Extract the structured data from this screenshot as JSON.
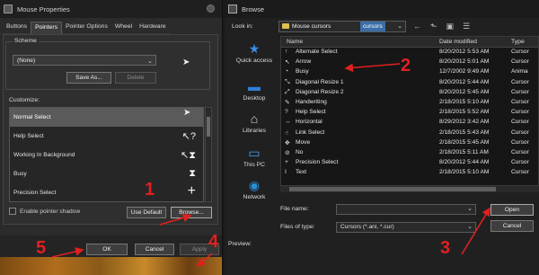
{
  "mouse_dialog": {
    "title": "Mouse Properties",
    "tabs": [
      {
        "label": "Buttons",
        "active": false
      },
      {
        "label": "Pointers",
        "active": true
      },
      {
        "label": "Pointer Options",
        "active": false
      },
      {
        "label": "Wheel",
        "active": false
      },
      {
        "label": "Hardware",
        "active": false
      }
    ],
    "scheme_label": "Scheme",
    "scheme_value": "(None)",
    "save_as_label": "Save As...",
    "delete_label": "Delete",
    "customize_label": "Customize:",
    "cursor_items": [
      {
        "label": "Normal Select",
        "selected": true,
        "icon": ""
      },
      {
        "label": "Help Select",
        "selected": false,
        "icon": "↖?"
      },
      {
        "label": "Working In Background",
        "selected": false,
        "icon": "↖⧗"
      },
      {
        "label": "Busy",
        "selected": false,
        "icon": "⧗"
      },
      {
        "label": "Precision Select",
        "selected": false,
        "icon": "+"
      }
    ],
    "shadow_label": "Enable pointer shadow",
    "use_default_label": "Use Default",
    "browse_label": "Browse...",
    "ok_label": "OK",
    "cancel_label": "Cancel",
    "apply_label": "Apply"
  },
  "browse_dialog": {
    "title": "Browse",
    "look_in_label": "Look in:",
    "look_in_value": "Mouse cursors",
    "look_in_selected": "cursors",
    "places": [
      {
        "label": "Quick access",
        "icon": "star-icon"
      },
      {
        "label": "Desktop",
        "icon": "desktop-icon"
      },
      {
        "label": "Libraries",
        "icon": "libraries-icon"
      },
      {
        "label": "This PC",
        "icon": "computer-icon"
      },
      {
        "label": "Network",
        "icon": "network-icon"
      }
    ],
    "columns": {
      "name": "Name",
      "date": "Date modified",
      "type": "Type"
    },
    "files": [
      {
        "name": "Alternate Select",
        "date": "8/20/2012 5:53 AM",
        "type": "Cursor"
      },
      {
        "name": "Arrow",
        "date": "8/20/2012 5:01 AM",
        "type": "Cursor"
      },
      {
        "name": "Busy",
        "date": "12/7/2002 9:49 AM",
        "type": "Anima"
      },
      {
        "name": "Diagonal Resize 1",
        "date": "8/20/2012 5:44 AM",
        "type": "Cursor"
      },
      {
        "name": "Diagonal Resize 2",
        "date": "8/20/2012 5:45 AM",
        "type": "Cursor"
      },
      {
        "name": "Handwriting",
        "date": "2/18/2015 5:10 AM",
        "type": "Cursor"
      },
      {
        "name": "Help Select",
        "date": "2/18/2015 5:52 AM",
        "type": "Cursor"
      },
      {
        "name": "Horizontal",
        "date": "8/29/2012 3:42 AM",
        "type": "Cursor"
      },
      {
        "name": "Link Select",
        "date": "2/18/2015 5:43 AM",
        "type": "Cursor"
      },
      {
        "name": "Move",
        "date": "2/18/2015 5:45 AM",
        "type": "Cursor"
      },
      {
        "name": "No",
        "date": "2/18/2015 5:11 AM",
        "type": "Cursor"
      },
      {
        "name": "Precision Select",
        "date": "8/20/2012 5:44 AM",
        "type": "Cursor"
      },
      {
        "name": "Text",
        "date": "2/18/2015 5:10 AM",
        "type": "Cursor"
      }
    ],
    "file_name_label": "File name:",
    "file_name_value": "",
    "files_of_type_label": "Files of type:",
    "files_of_type_value": "Cursors (*.ani, *.cur)",
    "open_label": "Open",
    "cancel_label": "Cancel",
    "preview_label": "Preview:"
  },
  "annotations": {
    "n1": "1",
    "n2": "2",
    "n3": "3",
    "n4": "4",
    "n5": "5"
  },
  "colors": {
    "annotation": "#e02020",
    "selection": "#3b6ea8"
  }
}
